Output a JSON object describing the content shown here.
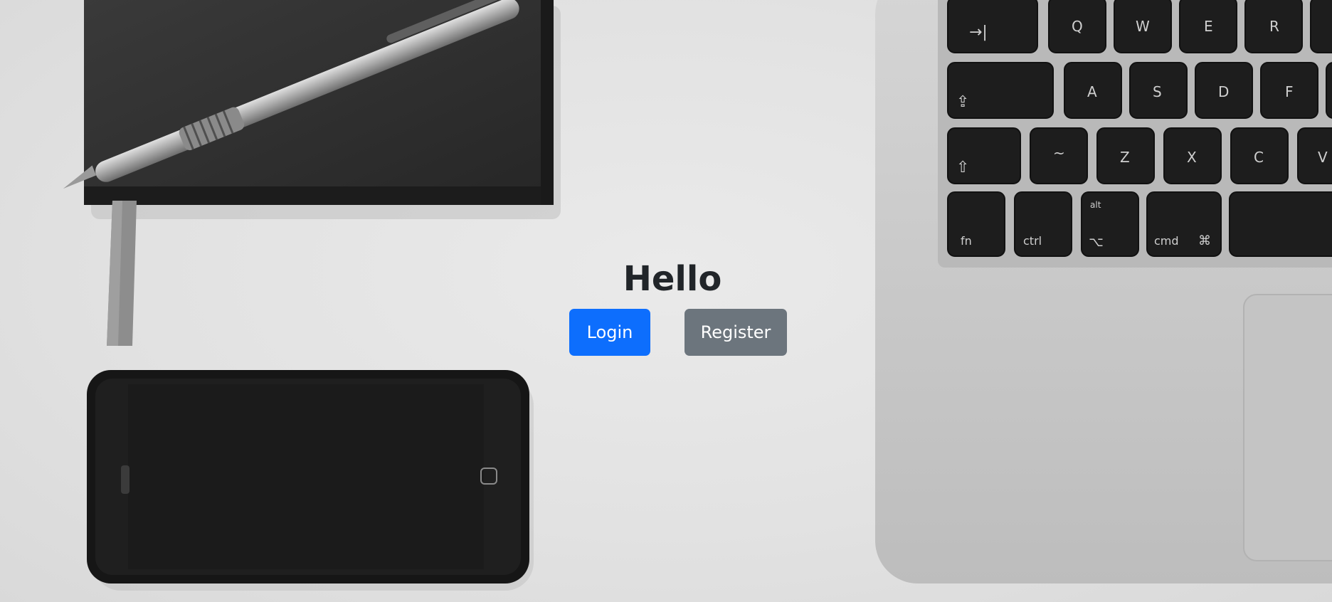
{
  "hero": {
    "heading": "Hello",
    "login_label": "Login",
    "register_label": "Register"
  },
  "keyboard": {
    "row1": [
      "→|",
      "Q",
      "W",
      "E",
      "R"
    ],
    "row2": [
      "⇪",
      "A",
      "S",
      "D",
      "F"
    ],
    "row3": [
      "⇧",
      "~",
      "Z",
      "X",
      "C",
      "V"
    ],
    "row4": [
      "fn",
      "ctrl",
      "alt",
      "⌥",
      "cmd",
      "⌘"
    ]
  },
  "colors": {
    "primary": "#0d6efd",
    "secondary": "#6c757d",
    "heading": "#212529"
  }
}
